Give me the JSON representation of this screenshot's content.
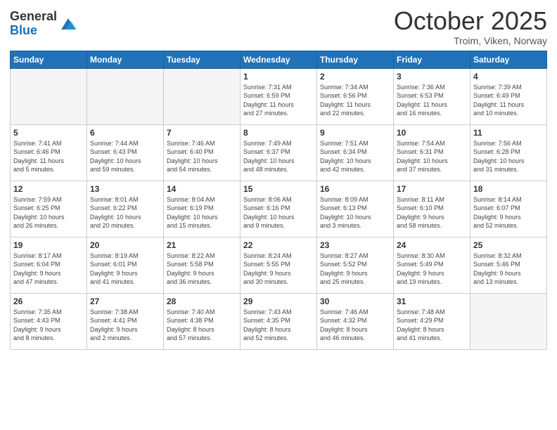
{
  "header": {
    "logo_general": "General",
    "logo_blue": "Blue",
    "title": "October 2025",
    "location": "Troim, Viken, Norway"
  },
  "weekdays": [
    "Sunday",
    "Monday",
    "Tuesday",
    "Wednesday",
    "Thursday",
    "Friday",
    "Saturday"
  ],
  "weeks": [
    [
      {
        "day": "",
        "info": ""
      },
      {
        "day": "",
        "info": ""
      },
      {
        "day": "",
        "info": ""
      },
      {
        "day": "1",
        "info": "Sunrise: 7:31 AM\nSunset: 6:59 PM\nDaylight: 11 hours\nand 27 minutes."
      },
      {
        "day": "2",
        "info": "Sunrise: 7:34 AM\nSunset: 6:56 PM\nDaylight: 11 hours\nand 22 minutes."
      },
      {
        "day": "3",
        "info": "Sunrise: 7:36 AM\nSunset: 6:53 PM\nDaylight: 11 hours\nand 16 minutes."
      },
      {
        "day": "4",
        "info": "Sunrise: 7:39 AM\nSunset: 6:49 PM\nDaylight: 11 hours\nand 10 minutes."
      }
    ],
    [
      {
        "day": "5",
        "info": "Sunrise: 7:41 AM\nSunset: 6:46 PM\nDaylight: 11 hours\nand 5 minutes."
      },
      {
        "day": "6",
        "info": "Sunrise: 7:44 AM\nSunset: 6:43 PM\nDaylight: 10 hours\nand 59 minutes."
      },
      {
        "day": "7",
        "info": "Sunrise: 7:46 AM\nSunset: 6:40 PM\nDaylight: 10 hours\nand 54 minutes."
      },
      {
        "day": "8",
        "info": "Sunrise: 7:49 AM\nSunset: 6:37 PM\nDaylight: 10 hours\nand 48 minutes."
      },
      {
        "day": "9",
        "info": "Sunrise: 7:51 AM\nSunset: 6:34 PM\nDaylight: 10 hours\nand 42 minutes."
      },
      {
        "day": "10",
        "info": "Sunrise: 7:54 AM\nSunset: 6:31 PM\nDaylight: 10 hours\nand 37 minutes."
      },
      {
        "day": "11",
        "info": "Sunrise: 7:56 AM\nSunset: 6:28 PM\nDaylight: 10 hours\nand 31 minutes."
      }
    ],
    [
      {
        "day": "12",
        "info": "Sunrise: 7:59 AM\nSunset: 6:25 PM\nDaylight: 10 hours\nand 26 minutes."
      },
      {
        "day": "13",
        "info": "Sunrise: 8:01 AM\nSunset: 6:22 PM\nDaylight: 10 hours\nand 20 minutes."
      },
      {
        "day": "14",
        "info": "Sunrise: 8:04 AM\nSunset: 6:19 PM\nDaylight: 10 hours\nand 15 minutes."
      },
      {
        "day": "15",
        "info": "Sunrise: 8:06 AM\nSunset: 6:16 PM\nDaylight: 10 hours\nand 9 minutes."
      },
      {
        "day": "16",
        "info": "Sunrise: 8:09 AM\nSunset: 6:13 PM\nDaylight: 10 hours\nand 3 minutes."
      },
      {
        "day": "17",
        "info": "Sunrise: 8:11 AM\nSunset: 6:10 PM\nDaylight: 9 hours\nand 58 minutes."
      },
      {
        "day": "18",
        "info": "Sunrise: 8:14 AM\nSunset: 6:07 PM\nDaylight: 9 hours\nand 52 minutes."
      }
    ],
    [
      {
        "day": "19",
        "info": "Sunrise: 8:17 AM\nSunset: 6:04 PM\nDaylight: 9 hours\nand 47 minutes."
      },
      {
        "day": "20",
        "info": "Sunrise: 8:19 AM\nSunset: 6:01 PM\nDaylight: 9 hours\nand 41 minutes."
      },
      {
        "day": "21",
        "info": "Sunrise: 8:22 AM\nSunset: 5:58 PM\nDaylight: 9 hours\nand 36 minutes."
      },
      {
        "day": "22",
        "info": "Sunrise: 8:24 AM\nSunset: 5:55 PM\nDaylight: 9 hours\nand 30 minutes."
      },
      {
        "day": "23",
        "info": "Sunrise: 8:27 AM\nSunset: 5:52 PM\nDaylight: 9 hours\nand 25 minutes."
      },
      {
        "day": "24",
        "info": "Sunrise: 8:30 AM\nSunset: 5:49 PM\nDaylight: 9 hours\nand 19 minutes."
      },
      {
        "day": "25",
        "info": "Sunrise: 8:32 AM\nSunset: 5:46 PM\nDaylight: 9 hours\nand 13 minutes."
      }
    ],
    [
      {
        "day": "26",
        "info": "Sunrise: 7:35 AM\nSunset: 4:43 PM\nDaylight: 9 hours\nand 8 minutes."
      },
      {
        "day": "27",
        "info": "Sunrise: 7:38 AM\nSunset: 4:41 PM\nDaylight: 9 hours\nand 2 minutes."
      },
      {
        "day": "28",
        "info": "Sunrise: 7:40 AM\nSunset: 4:38 PM\nDaylight: 8 hours\nand 57 minutes."
      },
      {
        "day": "29",
        "info": "Sunrise: 7:43 AM\nSunset: 4:35 PM\nDaylight: 8 hours\nand 52 minutes."
      },
      {
        "day": "30",
        "info": "Sunrise: 7:46 AM\nSunset: 4:32 PM\nDaylight: 8 hours\nand 46 minutes."
      },
      {
        "day": "31",
        "info": "Sunrise: 7:48 AM\nSunset: 4:29 PM\nDaylight: 8 hours\nand 41 minutes."
      },
      {
        "day": "",
        "info": ""
      }
    ]
  ]
}
